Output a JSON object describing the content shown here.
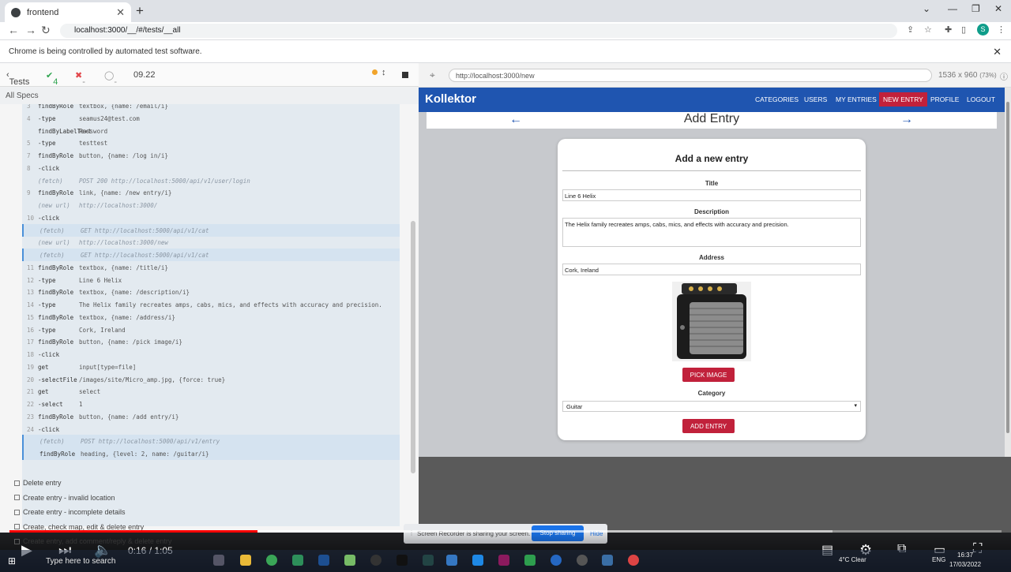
{
  "browser": {
    "tab_title": "frontend",
    "url": "localhost:3000/__/#/tests/__all",
    "profile_initial": "S",
    "automation_notice": "Chrome is being controlled by automated test software."
  },
  "cypress": {
    "back_label": "Tests",
    "passed": "4",
    "failed": "--",
    "pending": "--",
    "duration": "09.22",
    "all_specs": "All Specs",
    "commands": [
      {
        "n": "3",
        "name": "findByRole",
        "msg": "textbox, {name: /email/i}"
      },
      {
        "n": "4",
        "name": "-type",
        "msg": "seamus24@test.com"
      },
      {
        "n": "",
        "name": "findByLabelText",
        "msg": "Password"
      },
      {
        "n": "5",
        "name": "-type",
        "msg": "testtest"
      },
      {
        "n": "7",
        "name": "findByRole",
        "msg": "button, {name: /log in/i}"
      },
      {
        "n": "8",
        "name": "-click",
        "msg": ""
      },
      {
        "n": "",
        "name": "(fetch)",
        "msg": "POST 200 http://localhost:5000/api/v1/user/login"
      },
      {
        "n": "9",
        "name": "findByRole",
        "msg": "link, {name: /new entry/i}"
      },
      {
        "n": "",
        "name": "(new url)",
        "msg": "http://localhost:3000/"
      },
      {
        "n": "10",
        "name": "-click",
        "msg": ""
      },
      {
        "n": "",
        "name": "(fetch)",
        "msg": "GET http://localhost:5000/api/v1/cat"
      },
      {
        "n": "",
        "name": "(new url)",
        "msg": "http://localhost:3000/new"
      },
      {
        "n": "",
        "name": "(fetch)",
        "msg": "GET http://localhost:5000/api/v1/cat"
      },
      {
        "n": "11",
        "name": "findByRole",
        "msg": "textbox, {name: /title/i}"
      },
      {
        "n": "12",
        "name": "-type",
        "msg": "Line 6 Helix"
      },
      {
        "n": "13",
        "name": "findByRole",
        "msg": "textbox, {name: /description/i}"
      },
      {
        "n": "14",
        "name": "-type",
        "msg": "The Helix family recreates amps, cabs, mics, and effects with accuracy and precision."
      },
      {
        "n": "15",
        "name": "findByRole",
        "msg": "textbox, {name: /address/i}"
      },
      {
        "n": "16",
        "name": "-type",
        "msg": "Cork, Ireland"
      },
      {
        "n": "17",
        "name": "findByRole",
        "msg": "button, {name: /pick image/i}"
      },
      {
        "n": "18",
        "name": "-click",
        "msg": ""
      },
      {
        "n": "19",
        "name": "get",
        "msg": "input[type=file]"
      },
      {
        "n": "20",
        "name": "-selectFile",
        "msg": "/images/site/Micro_amp.jpg, {force: true}"
      },
      {
        "n": "21",
        "name": "get",
        "msg": "select"
      },
      {
        "n": "22",
        "name": "-select",
        "msg": "1"
      },
      {
        "n": "23",
        "name": "findByRole",
        "msg": "button, {name: /add entry/i}"
      },
      {
        "n": "24",
        "name": "-click",
        "msg": ""
      },
      {
        "n": "",
        "name": "(fetch)",
        "msg": "POST http://localhost:5000/api/v1/entry"
      },
      {
        "n": "",
        "name": "findByRole",
        "msg": "heading, {level: 2, name: /guitar/i}"
      }
    ],
    "specs": [
      "Delete entry",
      "Create entry - invalid location",
      "Create entry - incomplete details",
      "Create, check map, edit & delete entry",
      "Create entry, add comment/reply & delete entry"
    ]
  },
  "preview": {
    "url": "http://localhost:3000/new",
    "viewport": "1536 x 960",
    "zoom": "(73%)"
  },
  "app": {
    "brand": "Kollektor",
    "menu": [
      "CATEGORIES",
      "USERS",
      "MY ENTRIES",
      "NEW ENTRY",
      "PROFILE",
      "LOGOUT"
    ],
    "page_title": "Add Entry",
    "form_heading": "Add a new entry",
    "title_label": "Title",
    "title_value": "Line 6 Helix",
    "description_label": "Description",
    "description_value": "The Helix family recreates amps, cabs, mics, and effects with accuracy and precision.",
    "address_label": "Address",
    "address_value": "Cork, Ireland",
    "pick_image": "PICK IMAGE",
    "category_label": "Category",
    "category_value": "Guitar",
    "add_entry": "ADD ENTRY"
  },
  "screen_share": {
    "text": "Screen Recorder is sharing your screen.",
    "stop": "Stop sharing",
    "hide": "Hide"
  },
  "player": {
    "time": "0:16 / 1:05",
    "progress": 0.25
  },
  "taskbar": {
    "search": "Type here to search",
    "weather": "4°C  Clear",
    "time": "16:37",
    "date": "17/03/2022",
    "lang": "ENG"
  },
  "colors": {
    "app_nav": "#1f55b0",
    "accent_red": "#c1213b",
    "pass_green": "#2ea44f",
    "fail_red": "#e2474b"
  }
}
